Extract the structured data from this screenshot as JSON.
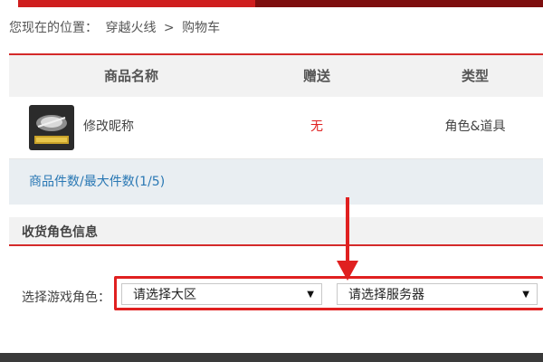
{
  "breadcrumb": {
    "prefix": "您现在的位置：",
    "items": [
      "穿越火线",
      "购物车"
    ],
    "separator": ">"
  },
  "cart": {
    "headers": {
      "name": "商品名称",
      "gift": "赠送",
      "type": "类型"
    },
    "item": {
      "thumbnail_icon": "item-thumbnail-icon",
      "name": "修改昵称",
      "gift": "无",
      "type": "角色&道具"
    },
    "count_text": "商品件数/最大件数(1/5)"
  },
  "receiver": {
    "section_title": "收货角色信息",
    "role_label": "选择游戏角色：",
    "region_select": {
      "value": "请选择大区"
    },
    "server_select": {
      "value": "请选择服务器"
    }
  },
  "colors": {
    "accent_red": "#d42a2a",
    "highlight_red": "#e02020",
    "link_blue": "#2a78b4"
  },
  "icons": {
    "dropdown": "▼"
  }
}
